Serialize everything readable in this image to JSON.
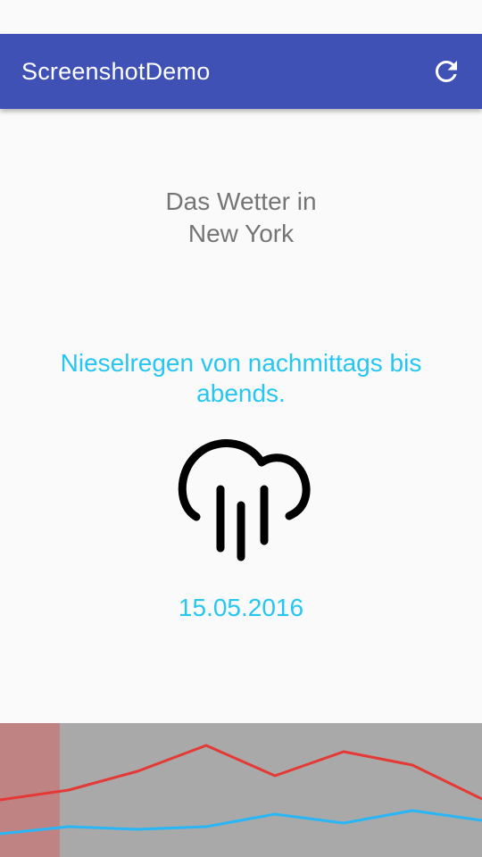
{
  "app_bar": {
    "title": "ScreenshotDemo",
    "background": "#3f51b5",
    "refresh_icon": "refresh-icon"
  },
  "weather": {
    "heading_line1": "Das Wetter in",
    "heading_line2": "New York",
    "condition": "Nieselregen von nachmittags bis abends.",
    "icon": "drizzle-cloud-icon",
    "date": "15.05.2016",
    "accent_color": "#26c6f2"
  },
  "chart_data": {
    "type": "line",
    "title": "",
    "x": [
      0,
      1,
      2,
      3,
      4,
      5,
      6,
      7
    ],
    "series": [
      {
        "color": "#e53935",
        "values": [
          64,
          75,
          96,
          125,
          91,
          118,
          103,
          65
        ]
      },
      {
        "color": "#29b6f6",
        "values": [
          26,
          34,
          31,
          34,
          48,
          38,
          52,
          41
        ]
      }
    ],
    "ylim": [
      0,
      150
    ],
    "highlight_index": 0,
    "highlight_color": "#c08383",
    "background": "#a9a9a9",
    "grid": false,
    "legend": "none"
  }
}
